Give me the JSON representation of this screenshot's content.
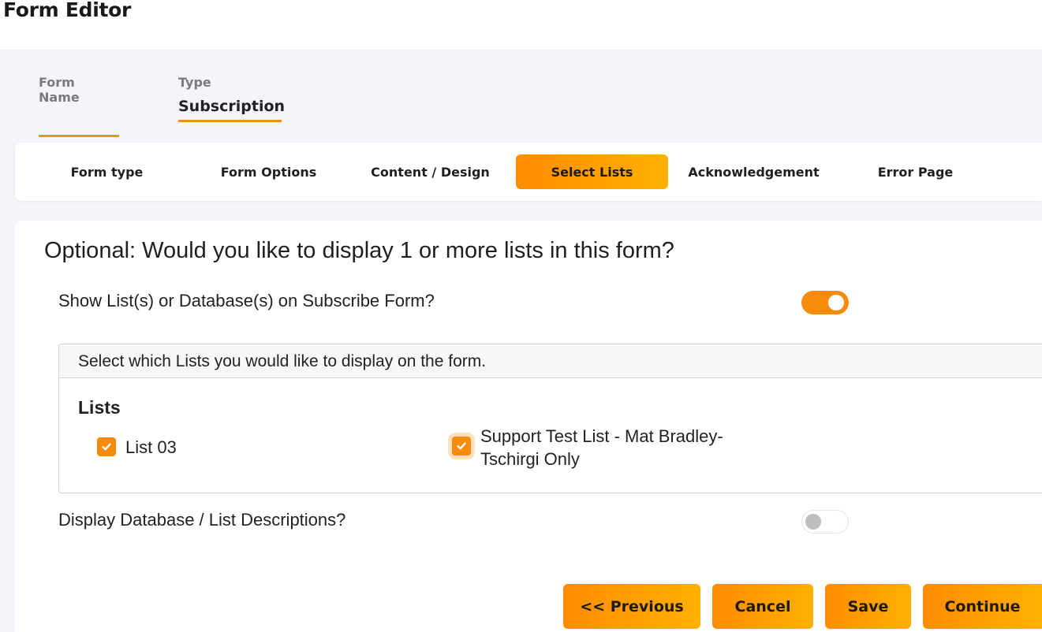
{
  "page": {
    "title": "Form Editor"
  },
  "meta": {
    "form_name": {
      "label": "Form Name",
      "value": ""
    },
    "type": {
      "label": "Type",
      "value": "Subscription"
    }
  },
  "tabs": [
    {
      "label": "Form type",
      "active": false
    },
    {
      "label": "Form Options",
      "active": false
    },
    {
      "label": "Content / Design",
      "active": false
    },
    {
      "label": "Select Lists",
      "active": true
    },
    {
      "label": "Acknowledgement",
      "active": false
    },
    {
      "label": "Error Page",
      "active": false
    }
  ],
  "main": {
    "question": "Optional: Would you like to display 1 or more lists in this form?",
    "show_lists": {
      "label": "Show List(s) or Database(s) on Subscribe Form?",
      "checked": true
    },
    "lists_panel": {
      "header": "Select which Lists you would like to display on the form.",
      "title": "Lists",
      "items": [
        {
          "label": "List 03",
          "checked": true
        },
        {
          "label": "Support Test List - Mat Bradley-Tschirgi Only",
          "checked": true
        }
      ]
    },
    "display_descriptions": {
      "label": "Display Database / List Descriptions?",
      "checked": false
    }
  },
  "buttons": {
    "previous": "<< Previous",
    "cancel": "Cancel",
    "save": "Save",
    "continue": "Continue"
  },
  "colors": {
    "accent": "#f68b0c",
    "accent_light": "#ffb000",
    "background": "#f3f5fb"
  },
  "icons": {
    "check": "check-icon"
  }
}
